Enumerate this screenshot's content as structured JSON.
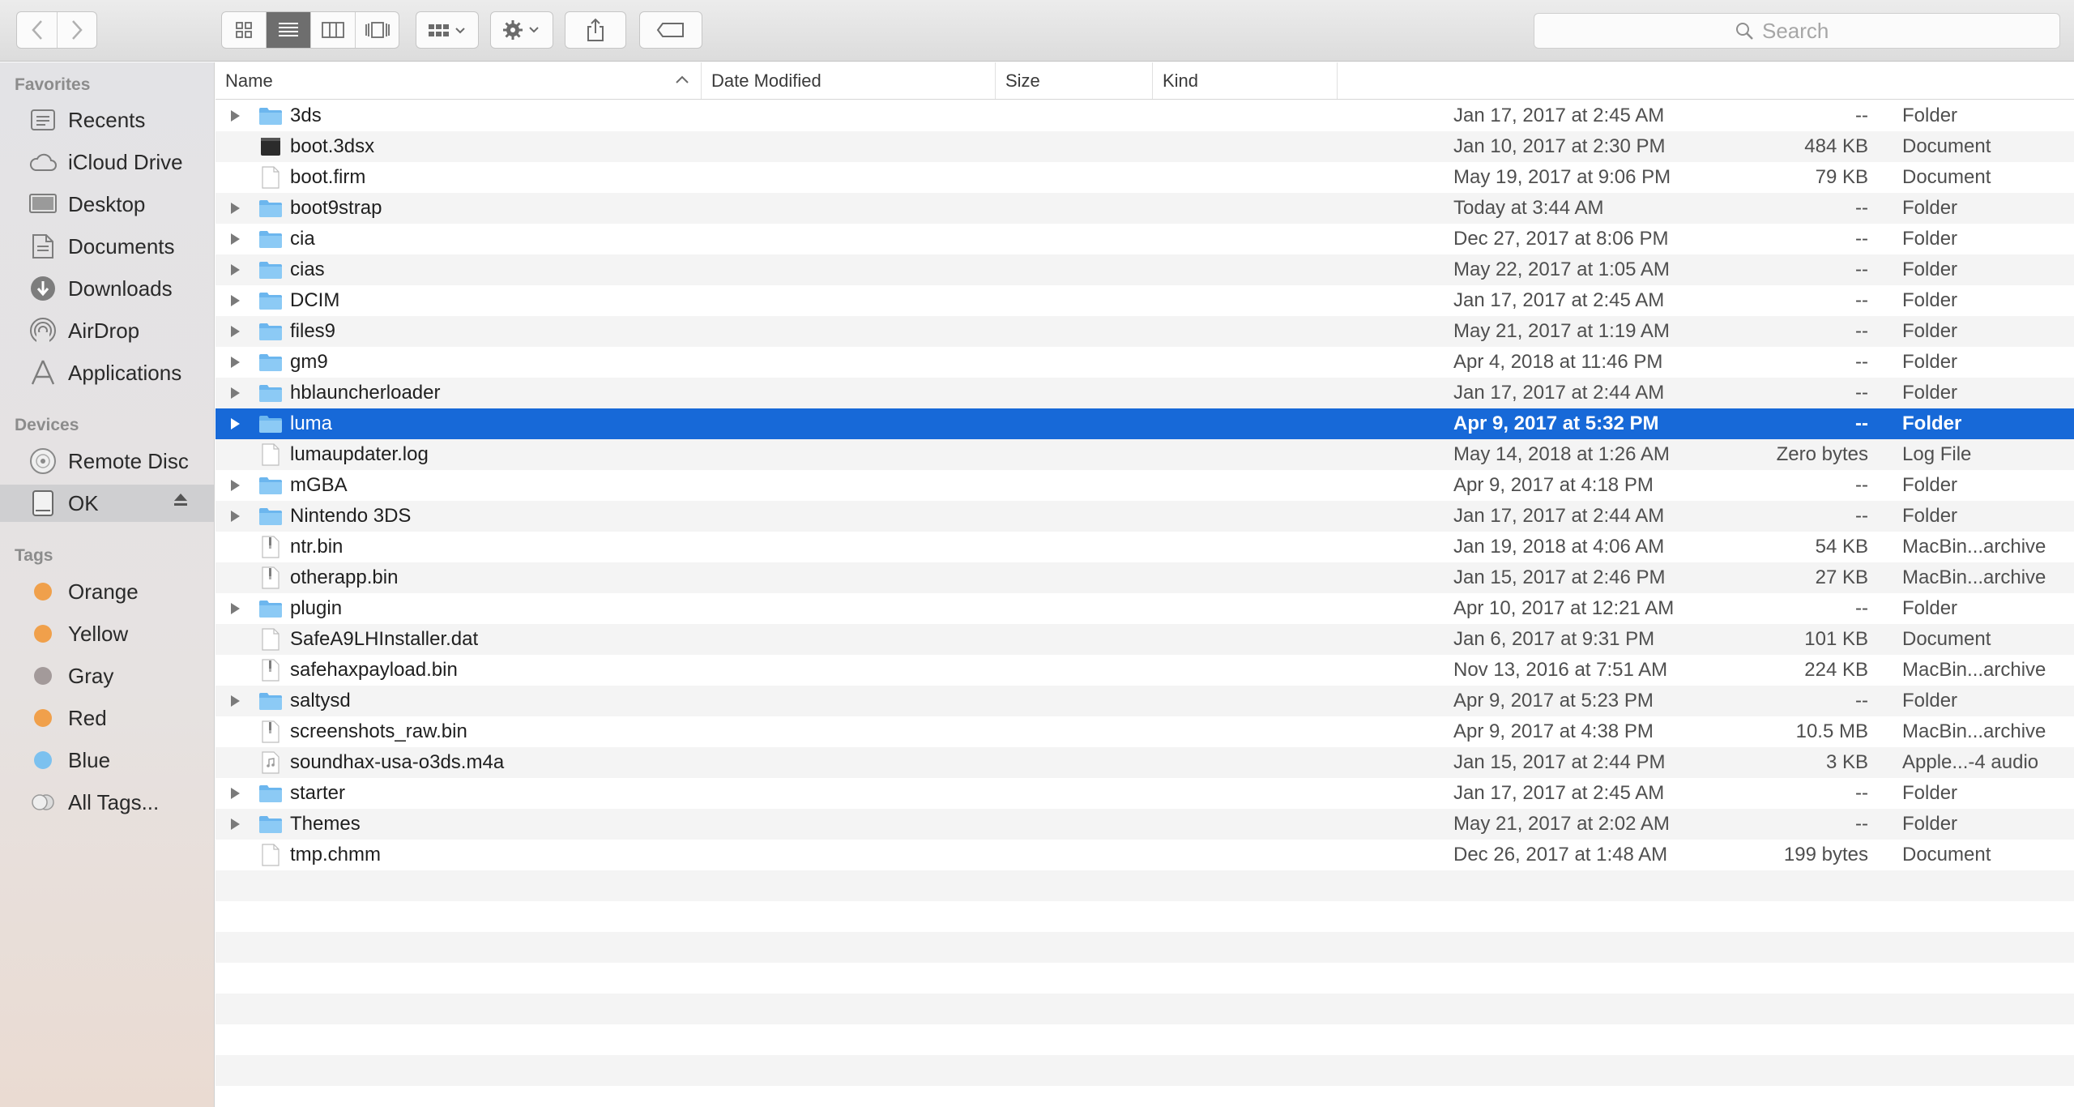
{
  "search": {
    "placeholder": "Search"
  },
  "sidebar": {
    "favorites_heading": "Favorites",
    "favorites": [
      {
        "label": "Recents",
        "icon": "recents-icon"
      },
      {
        "label": "iCloud Drive",
        "icon": "cloud-icon"
      },
      {
        "label": "Desktop",
        "icon": "desktop-icon"
      },
      {
        "label": "Documents",
        "icon": "documents-icon"
      },
      {
        "label": "Downloads",
        "icon": "downloads-icon"
      },
      {
        "label": "AirDrop",
        "icon": "airdrop-icon"
      },
      {
        "label": "Applications",
        "icon": "applications-icon"
      }
    ],
    "devices_heading": "Devices",
    "devices": [
      {
        "label": "Remote Disc",
        "icon": "disc-icon"
      },
      {
        "label": "OK",
        "icon": "drive-icon"
      }
    ],
    "tags_heading": "Tags",
    "tags": [
      {
        "label": "Orange",
        "color": "#f0a04b"
      },
      {
        "label": "Yellow",
        "color": "#f0a04b"
      },
      {
        "label": "Gray",
        "color": "#a39a9a"
      },
      {
        "label": "Red",
        "color": "#f0a04b"
      },
      {
        "label": "Blue",
        "color": "#7cc1ef"
      },
      {
        "label": "All Tags...",
        "color": ""
      }
    ]
  },
  "columns": {
    "name": "Name",
    "date_modified": "Date Modified",
    "size": "Size",
    "kind": "Kind"
  },
  "files": [
    {
      "name": "3ds",
      "date": "Jan 17, 2017 at 2:45 AM",
      "size": "--",
      "kind": "Folder",
      "type": "folder"
    },
    {
      "name": "boot.3dsx",
      "date": "Jan 10, 2017 at 2:30 PM",
      "size": "484 KB",
      "kind": "Document",
      "type": "exec"
    },
    {
      "name": "boot.firm",
      "date": "May 19, 2017 at 9:06 PM",
      "size": "79 KB",
      "kind": "Document",
      "type": "doc"
    },
    {
      "name": "boot9strap",
      "date": "Today at 3:44 AM",
      "size": "--",
      "kind": "Folder",
      "type": "folder"
    },
    {
      "name": "cia",
      "date": "Dec 27, 2017 at 8:06 PM",
      "size": "--",
      "kind": "Folder",
      "type": "folder"
    },
    {
      "name": "cias",
      "date": "May 22, 2017 at 1:05 AM",
      "size": "--",
      "kind": "Folder",
      "type": "folder"
    },
    {
      "name": "DCIM",
      "date": "Jan 17, 2017 at 2:45 AM",
      "size": "--",
      "kind": "Folder",
      "type": "folder"
    },
    {
      "name": "files9",
      "date": "May 21, 2017 at 1:19 AM",
      "size": "--",
      "kind": "Folder",
      "type": "folder"
    },
    {
      "name": "gm9",
      "date": "Apr 4, 2018 at 11:46 PM",
      "size": "--",
      "kind": "Folder",
      "type": "folder"
    },
    {
      "name": "hblauncherloader",
      "date": "Jan 17, 2017 at 2:44 AM",
      "size": "--",
      "kind": "Folder",
      "type": "folder"
    },
    {
      "name": "luma",
      "date": "Apr 9, 2017 at 5:32 PM",
      "size": "--",
      "kind": "Folder",
      "type": "folder",
      "selected": true
    },
    {
      "name": "lumaupdater.log",
      "date": "May 14, 2018 at 1:26 AM",
      "size": "Zero bytes",
      "kind": "Log File",
      "type": "doc"
    },
    {
      "name": "mGBA",
      "date": "Apr 9, 2017 at 4:18 PM",
      "size": "--",
      "kind": "Folder",
      "type": "folder"
    },
    {
      "name": "Nintendo 3DS",
      "date": "Jan 17, 2017 at 2:44 AM",
      "size": "--",
      "kind": "Folder",
      "type": "folder"
    },
    {
      "name": "ntr.bin",
      "date": "Jan 19, 2018 at 4:06 AM",
      "size": "54 KB",
      "kind": "MacBin...archive",
      "type": "archive"
    },
    {
      "name": "otherapp.bin",
      "date": "Jan 15, 2017 at 2:46 PM",
      "size": "27 KB",
      "kind": "MacBin...archive",
      "type": "archive"
    },
    {
      "name": "plugin",
      "date": "Apr 10, 2017 at 12:21 AM",
      "size": "--",
      "kind": "Folder",
      "type": "folder"
    },
    {
      "name": "SafeA9LHInstaller.dat",
      "date": "Jan 6, 2017 at 9:31 PM",
      "size": "101 KB",
      "kind": "Document",
      "type": "doc"
    },
    {
      "name": "safehaxpayload.bin",
      "date": "Nov 13, 2016 at 7:51 AM",
      "size": "224 KB",
      "kind": "MacBin...archive",
      "type": "archive"
    },
    {
      "name": "saltysd",
      "date": "Apr 9, 2017 at 5:23 PM",
      "size": "--",
      "kind": "Folder",
      "type": "folder"
    },
    {
      "name": "screenshots_raw.bin",
      "date": "Apr 9, 2017 at 4:38 PM",
      "size": "10.5 MB",
      "kind": "MacBin...archive",
      "type": "archive"
    },
    {
      "name": "soundhax-usa-o3ds.m4a",
      "date": "Jan 15, 2017 at 2:44 PM",
      "size": "3 KB",
      "kind": "Apple...-4 audio",
      "type": "audio"
    },
    {
      "name": "starter",
      "date": "Jan 17, 2017 at 2:45 AM",
      "size": "--",
      "kind": "Folder",
      "type": "folder"
    },
    {
      "name": "Themes",
      "date": "May 21, 2017 at 2:02 AM",
      "size": "--",
      "kind": "Folder",
      "type": "folder"
    },
    {
      "name": "tmp.chmm",
      "date": "Dec 26, 2017 at 1:48 AM",
      "size": "199 bytes",
      "kind": "Document",
      "type": "doc"
    }
  ],
  "colors": {
    "selection": "#1769d8",
    "folder": "#6cb6ee"
  }
}
